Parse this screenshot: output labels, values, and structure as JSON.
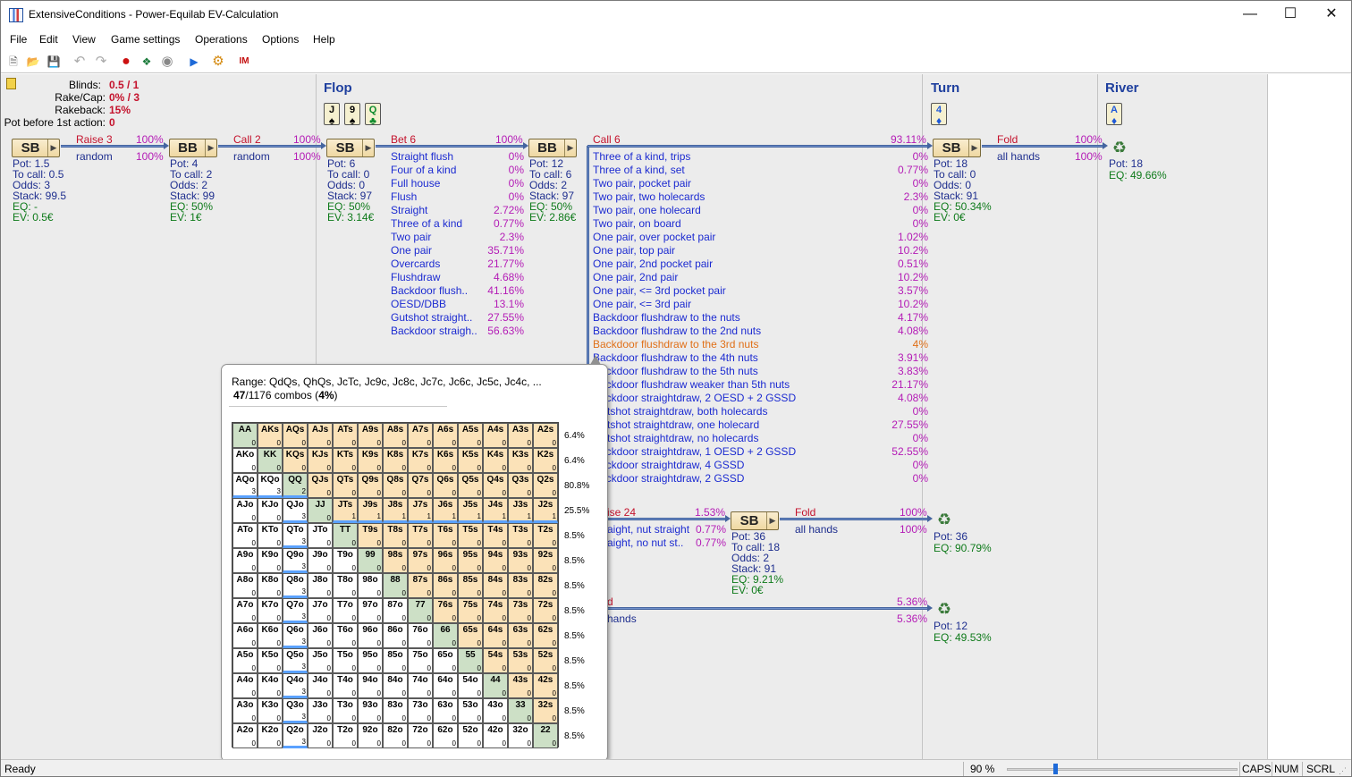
{
  "window": {
    "title": "ExtensiveConditions - Power-Equilab EV-Calculation",
    "minimize": "—",
    "maximize": "☐",
    "close": "✕"
  },
  "menu": [
    "File",
    "Edit",
    "View",
    "Game settings",
    "Operations",
    "Options",
    "Help"
  ],
  "toolbar": [
    {
      "name": "new-icon",
      "glyph": "🗎"
    },
    {
      "name": "open-icon",
      "glyph": "📂"
    },
    {
      "name": "save-icon",
      "glyph": "💾"
    },
    {
      "name": "undo-icon",
      "glyph": "↶"
    },
    {
      "name": "redo-icon",
      "glyph": "↷"
    },
    {
      "name": "chip-red-icon",
      "glyph": "●"
    },
    {
      "name": "chips-icon",
      "glyph": "❖"
    },
    {
      "name": "stop-icon",
      "glyph": "◉"
    },
    {
      "name": "play-icon",
      "glyph": "▶"
    },
    {
      "name": "settings-icon",
      "glyph": "⚙"
    },
    {
      "name": "logo-icon",
      "glyph": "IM"
    }
  ],
  "settings": {
    "blinds_label": "Blinds:",
    "blinds": "0.5 / 1",
    "rake_label": "Rake/Cap:",
    "rake": "0% / 3",
    "rakeback_label": "Rakeback:",
    "rakeback": "15%",
    "pot_label": "Pot before 1st action:",
    "pot": "0"
  },
  "streets": {
    "flop": {
      "name": "Flop",
      "cards": [
        {
          "rank": "J",
          "suit": "♠",
          "color": "blk"
        },
        {
          "rank": "9",
          "suit": "♠",
          "color": "blk"
        },
        {
          "rank": "Q",
          "suit": "♣",
          "color": "grn"
        }
      ]
    },
    "turn": {
      "name": "Turn",
      "cards": [
        {
          "rank": "4",
          "suit": "♦",
          "color": "blu"
        }
      ]
    },
    "river": {
      "name": "River",
      "cards": [
        {
          "rank": "A",
          "suit": "♦",
          "color": "blu"
        }
      ]
    }
  },
  "nodes": {
    "sb1": {
      "label": "SB",
      "pot": "Pot: 1.5",
      "tocall": "To call: 0.5",
      "odds": "Odds: 3",
      "stack": "Stack: 99.5",
      "eq": "EQ: -",
      "ev": "EV: 0.5€"
    },
    "bb1": {
      "label": "BB",
      "pot": "Pot: 4",
      "tocall": "To call: 2",
      "odds": "Odds: 2",
      "stack": "Stack: 99",
      "eq": "EQ: 50%",
      "ev": "EV: 1€"
    },
    "sb2": {
      "label": "SB",
      "pot": "Pot: 6",
      "tocall": "To call: 0",
      "odds": "Odds: 0",
      "stack": "Stack: 97",
      "eq": "EQ: 50%",
      "ev": "EV: 3.14€"
    },
    "bb2": {
      "label": "BB",
      "pot": "Pot: 12",
      "tocall": "To call: 6",
      "odds": "Odds: 2",
      "stack": "Stack: 97",
      "eq": "EQ: 50%",
      "ev": "EV: 2.86€"
    },
    "sb3": {
      "label": "SB",
      "pot": "Pot: 18",
      "tocall": "To call: 0",
      "odds": "Odds: 0",
      "stack": "Stack: 91",
      "eq": "EQ: 50.34%",
      "ev": "EV: 0€"
    },
    "sb4": {
      "label": "SB",
      "pot": "Pot: 36",
      "tocall": "To call: 18",
      "odds": "Odds: 2",
      "stack": "Stack: 91",
      "eq": "EQ: 9.21%",
      "ev": "EV: 0€"
    }
  },
  "actions": {
    "raise3": {
      "label": "Raise 3",
      "pct": "100%",
      "sub": "random",
      "subpct": "100%"
    },
    "call2": {
      "label": "Call 2",
      "pct": "100%",
      "sub": "random",
      "subpct": "100%"
    },
    "bet6": {
      "label": "Bet 6",
      "pct": "100%"
    },
    "call6": {
      "label": "Call 6",
      "pct": "93.11%"
    },
    "fold1": {
      "label": "Fold",
      "pct": "100%",
      "sub": "all hands",
      "subpct": "100%"
    },
    "raise24": {
      "label": "ise 24",
      "pct": "1.53%"
    },
    "fold2": {
      "label": "Fold",
      "pct": "100%",
      "sub": "all hands",
      "subpct": "100%"
    },
    "fold3": {
      "label": "d",
      "pct": "5.36%",
      "sub": "hands",
      "subpct": "5.36%"
    }
  },
  "bet6_list": [
    {
      "label": "Straight flush",
      "pct": "0%"
    },
    {
      "label": "Four of a kind",
      "pct": "0%"
    },
    {
      "label": "Full house",
      "pct": "0%"
    },
    {
      "label": "Flush",
      "pct": "0%"
    },
    {
      "label": "Straight",
      "pct": "2.72%"
    },
    {
      "label": "Three of a kind",
      "pct": "0.77%"
    },
    {
      "label": "Two pair",
      "pct": "2.3%"
    },
    {
      "label": "One pair",
      "pct": "35.71%"
    },
    {
      "label": "Overcards",
      "pct": "21.77%"
    },
    {
      "label": "Flushdraw",
      "pct": "4.68%"
    },
    {
      "label": "Backdoor flush..",
      "pct": "41.16%"
    },
    {
      "label": "OESD/DBB",
      "pct": "13.1%"
    },
    {
      "label": "Gutshot straight..",
      "pct": "27.55%"
    },
    {
      "label": "Backdoor straigh..",
      "pct": "56.63%"
    }
  ],
  "call6_list": [
    {
      "label": "Three of a kind, trips",
      "pct": "0%"
    },
    {
      "label": "Three of a kind, set",
      "pct": "0.77%"
    },
    {
      "label": "Two pair, pocket pair",
      "pct": "0%"
    },
    {
      "label": "Two pair, two holecards",
      "pct": "2.3%"
    },
    {
      "label": "Two pair, one holecard",
      "pct": "0%"
    },
    {
      "label": "Two pair, on board",
      "pct": "0%"
    },
    {
      "label": "One pair, over pocket pair",
      "pct": "1.02%"
    },
    {
      "label": "One pair, top pair",
      "pct": "10.2%"
    },
    {
      "label": "One pair, 2nd pocket pair",
      "pct": "0.51%"
    },
    {
      "label": "One pair, 2nd pair",
      "pct": "10.2%"
    },
    {
      "label": "One pair, <= 3rd pocket pair",
      "pct": "3.57%"
    },
    {
      "label": "One pair, <= 3rd pair",
      "pct": "10.2%"
    },
    {
      "label": "Backdoor flushdraw to the nuts",
      "pct": "4.17%"
    },
    {
      "label": "Backdoor flushdraw to the 2nd nuts",
      "pct": "4.08%"
    },
    {
      "label": "Backdoor flushdraw to the 3rd nuts",
      "pct": "4%",
      "highlight": true
    },
    {
      "label": "Backdoor flushdraw to the 4th nuts",
      "pct": "3.91%"
    },
    {
      "label": "Backdoor flushdraw to the 5th nuts",
      "pct": "3.83%"
    },
    {
      "label": "Backdoor flushdraw weaker than 5th nuts",
      "pct": "21.17%"
    },
    {
      "label": "Backdoor straightdraw, 2 OESD + 2 GSSD",
      "pct": "4.08%"
    },
    {
      "label": "Gutshot straightdraw, both holecards",
      "pct": "0%"
    },
    {
      "label": "Gutshot straightdraw, one holecard",
      "pct": "27.55%"
    },
    {
      "label": "Gutshot straightdraw, no holecards",
      "pct": "0%"
    },
    {
      "label": "Backdoor straightdraw, 1 OESD + 2 GSSD",
      "pct": "52.55%"
    },
    {
      "label": "Backdoor straightdraw, 4 GSSD",
      "pct": "0%"
    },
    {
      "label": "Backdoor straightdraw, 2 GSSD",
      "pct": "0%"
    }
  ],
  "raise24_list": [
    {
      "label": "aight, nut straight",
      "pct": "0.77%"
    },
    {
      "label": "aight, no nut st..",
      "pct": "0.77%"
    }
  ],
  "terminals": {
    "t1": {
      "pot": "Pot: 18",
      "eq": "EQ: 49.66%"
    },
    "t2": {
      "pot": "Pot: 36",
      "eq": "EQ: 90.79%"
    },
    "t3": {
      "pot": "Pot: 12",
      "eq": "EQ: 49.53%"
    }
  },
  "popup": {
    "range": "Range: QdQs, QhQs, JcTc, Jc9c, Jc8c, Jc7c, Jc6c, Jc5c, Jc4c,   ...",
    "combos_count": "47",
    "combos_total": "/1176 combos (",
    "combos_pct": "4%",
    "combos_end": ")",
    "row_pcts": [
      "6.4%",
      "6.4%",
      "80.8%",
      "25.5%",
      "8.5%",
      "8.5%",
      "8.5%",
      "8.5%",
      "8.5%",
      "8.5%",
      "8.5%",
      "8.5%",
      "8.5%"
    ],
    "grid": [
      [
        "AA:0",
        "AKs:0",
        "AQs:0",
        "AJs:0",
        "ATs:0",
        "A9s:0",
        "A8s:0",
        "A7s:0",
        "A6s:0",
        "A5s:0",
        "A4s:0",
        "A3s:0",
        "A2s:0"
      ],
      [
        "AKo:0",
        "KK:0",
        "KQs:0",
        "KJs:0",
        "KTs:0",
        "K9s:0",
        "K8s:0",
        "K7s:0",
        "K6s:0",
        "K5s:0",
        "K4s:0",
        "K3s:0",
        "K2s:0"
      ],
      [
        "AQo:3",
        "KQo:3",
        "QQ:2",
        "QJs:0",
        "QTs:0",
        "Q9s:0",
        "Q8s:0",
        "Q7s:0",
        "Q6s:0",
        "Q5s:0",
        "Q4s:0",
        "Q3s:0",
        "Q2s:0"
      ],
      [
        "AJo:0",
        "KJo:0",
        "QJo:3",
        "JJ:0",
        "JTs:1",
        "J9s:1",
        "J8s:1",
        "J7s:1",
        "J6s:1",
        "J5s:1",
        "J4s:1",
        "J3s:1",
        "J2s:1"
      ],
      [
        "ATo:0",
        "KTo:0",
        "QTo:3",
        "JTo:0",
        "TT:0",
        "T9s:0",
        "T8s:0",
        "T7s:0",
        "T6s:0",
        "T5s:0",
        "T4s:0",
        "T3s:0",
        "T2s:0"
      ],
      [
        "A9o:0",
        "K9o:0",
        "Q9o:3",
        "J9o:0",
        "T9o:0",
        "99:0",
        "98s:0",
        "97s:0",
        "96s:0",
        "95s:0",
        "94s:0",
        "93s:0",
        "92s:0"
      ],
      [
        "A8o:0",
        "K8o:0",
        "Q8o:3",
        "J8o:0",
        "T8o:0",
        "98o:0",
        "88:0",
        "87s:0",
        "86s:0",
        "85s:0",
        "84s:0",
        "83s:0",
        "82s:0"
      ],
      [
        "A7o:0",
        "K7o:0",
        "Q7o:3",
        "J7o:0",
        "T7o:0",
        "97o:0",
        "87o:0",
        "77:0",
        "76s:0",
        "75s:0",
        "74s:0",
        "73s:0",
        "72s:0"
      ],
      [
        "A6o:0",
        "K6o:0",
        "Q6o:3",
        "J6o:0",
        "T6o:0",
        "96o:0",
        "86o:0",
        "76o:0",
        "66:0",
        "65s:0",
        "64s:0",
        "63s:0",
        "62s:0"
      ],
      [
        "A5o:0",
        "K5o:0",
        "Q5o:3",
        "J5o:0",
        "T5o:0",
        "95o:0",
        "85o:0",
        "75o:0",
        "65o:0",
        "55:0",
        "54s:0",
        "53s:0",
        "52s:0"
      ],
      [
        "A4o:0",
        "K4o:0",
        "Q4o:3",
        "J4o:0",
        "T4o:0",
        "94o:0",
        "84o:0",
        "74o:0",
        "64o:0",
        "54o:0",
        "44:0",
        "43s:0",
        "42s:0"
      ],
      [
        "A3o:0",
        "K3o:0",
        "Q3o:3",
        "J3o:0",
        "T3o:0",
        "93o:0",
        "83o:0",
        "73o:0",
        "63o:0",
        "53o:0",
        "43o:0",
        "33:0",
        "32s:0"
      ],
      [
        "A2o:0",
        "K2o:0",
        "Q2o:3",
        "J2o:0",
        "T2o:0",
        "92o:0",
        "82o:0",
        "72o:0",
        "62o:0",
        "52o:0",
        "42o:0",
        "32o:0",
        "22:0"
      ]
    ]
  },
  "status": {
    "text": "Ready",
    "zoom": "90 %",
    "zoom_level": 0.2,
    "caps": "CAPS",
    "num": "NUM",
    "scrl": "SCRL"
  }
}
